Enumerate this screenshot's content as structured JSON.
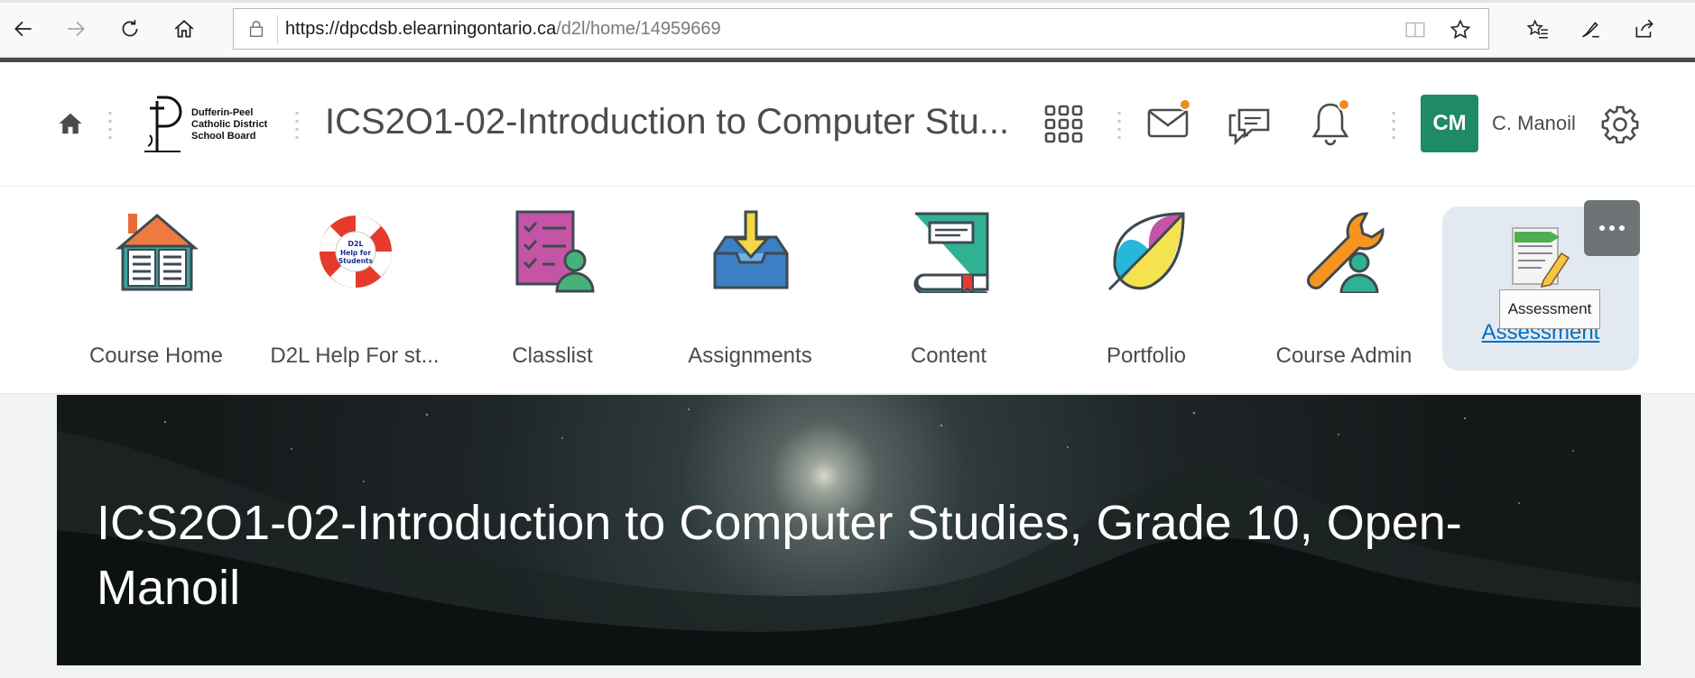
{
  "browser": {
    "url_host": "https://dpcdsb.elearningontario.ca",
    "url_path": "/d2l/home/14959669"
  },
  "navbar": {
    "logo_text": "Dufferin-Peel Catholic District School Board",
    "logo_line1": "Dufferin-Peel",
    "logo_line2": "Catholic District",
    "logo_line3": "School Board",
    "course_title": "ICS2O1-02-Introduction to Computer Stu...",
    "user_initials": "CM",
    "user_name": "C. Manoil"
  },
  "tiles": [
    {
      "label": "Course Home"
    },
    {
      "label": "D2L Help For st..."
    },
    {
      "label": "Classlist"
    },
    {
      "label": "Assignments"
    },
    {
      "label": "Content"
    },
    {
      "label": "Portfolio"
    },
    {
      "label": "Course Admin"
    },
    {
      "label": "Assessment"
    }
  ],
  "d2l_help_icon_text": "D2L Help for Students",
  "tooltip": "Assessment",
  "banner": {
    "title": "ICS2O1-02-Introduction to Computer Studies, Grade 10, Open-Manoil"
  },
  "colors": {
    "avatar": "#1e8a66",
    "notification_badge": "#f08a24",
    "active_link": "#006fbf"
  }
}
